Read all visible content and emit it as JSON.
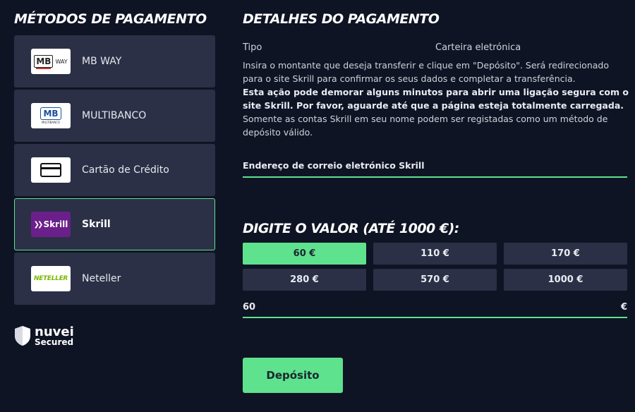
{
  "left": {
    "title": "MÉTODOS DE PAGAMENTO",
    "methods": [
      {
        "label": "MB WAY",
        "logo_text": "MB",
        "logo_sub": "WAY",
        "icon": "mbway-logo-icon"
      },
      {
        "label": "MULTIBANCO",
        "logo_text": "MB",
        "logo_sub": "MULTIBANCO",
        "icon": "multibanco-logo-icon"
      },
      {
        "label": "Cartão de Crédito",
        "icon": "credit-card-icon"
      },
      {
        "label": "Skrill",
        "logo_text": "Skrill",
        "icon": "skrill-logo-icon",
        "selected": true
      },
      {
        "label": "Neteller",
        "logo_text": "NETELLER",
        "icon": "neteller-logo-icon"
      }
    ],
    "brand": {
      "name": "nuvei",
      "tagline": "Secured",
      "icon": "shield-icon"
    }
  },
  "details": {
    "title": "DETALHES DO PAGAMENTO",
    "type_label": "Tipo",
    "type_value": "Carteira eletrónica",
    "desc1": "Insira o montante que deseja transferir e clique em \"Depósito\". Será redirecionado para o site Skrill para confirmar os seus dados e completar a transferência.",
    "desc2": "Esta ação pode demorar alguns minutos para abrir uma ligação segura com o site Skrill. Por favor, aguarde até que a página esteja totalmente carregada.",
    "desc3": "Somente as contas Skrill em seu nome podem ser registadas como um método de depósito válido.",
    "email_label": "Endereço de correio eletrónico Skrill"
  },
  "amount": {
    "title": "DIGITE O VALOR (ATÉ 1000 €):",
    "options": [
      "60 €",
      "110 €",
      "170 €",
      "280 €",
      "570 €",
      "1000 €"
    ],
    "selected_index": 0,
    "value": "60",
    "currency": "€"
  },
  "deposit_label": "Depósito",
  "colors": {
    "accent": "#5ee28e",
    "panel": "#2b3046",
    "background": "#0f1424"
  }
}
